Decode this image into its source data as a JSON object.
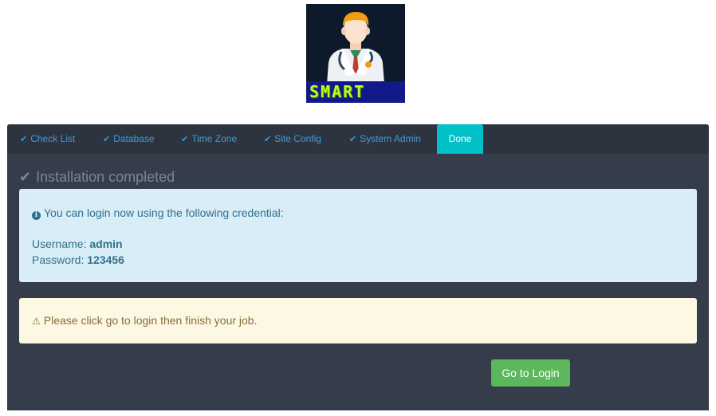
{
  "logo": {
    "text": "SMART",
    "icon": "doctor-icon"
  },
  "tabs": [
    {
      "label": "Check List",
      "done": true
    },
    {
      "label": "Database",
      "done": true
    },
    {
      "label": "Time Zone",
      "done": true
    },
    {
      "label": "Site Config",
      "done": true
    },
    {
      "label": "System Admin",
      "done": true
    },
    {
      "label": "Done",
      "active": true
    }
  ],
  "heading": "Installation completed",
  "info": {
    "message": "You can login now using the following credential:",
    "username_label": "Username:",
    "username_value": "admin",
    "password_label": "Password:",
    "password_value": "123456"
  },
  "warning": {
    "message": "Please click go to login then finish your job."
  },
  "button": {
    "label": "Go to Login"
  },
  "colors": {
    "active_tab": "#00c0c8",
    "panel_bg": "#353d4a",
    "tab_link": "#3e9ad6",
    "info_bg": "#d9edf7",
    "warn_bg": "#fcf8e3",
    "button_bg": "#5cb85c"
  }
}
